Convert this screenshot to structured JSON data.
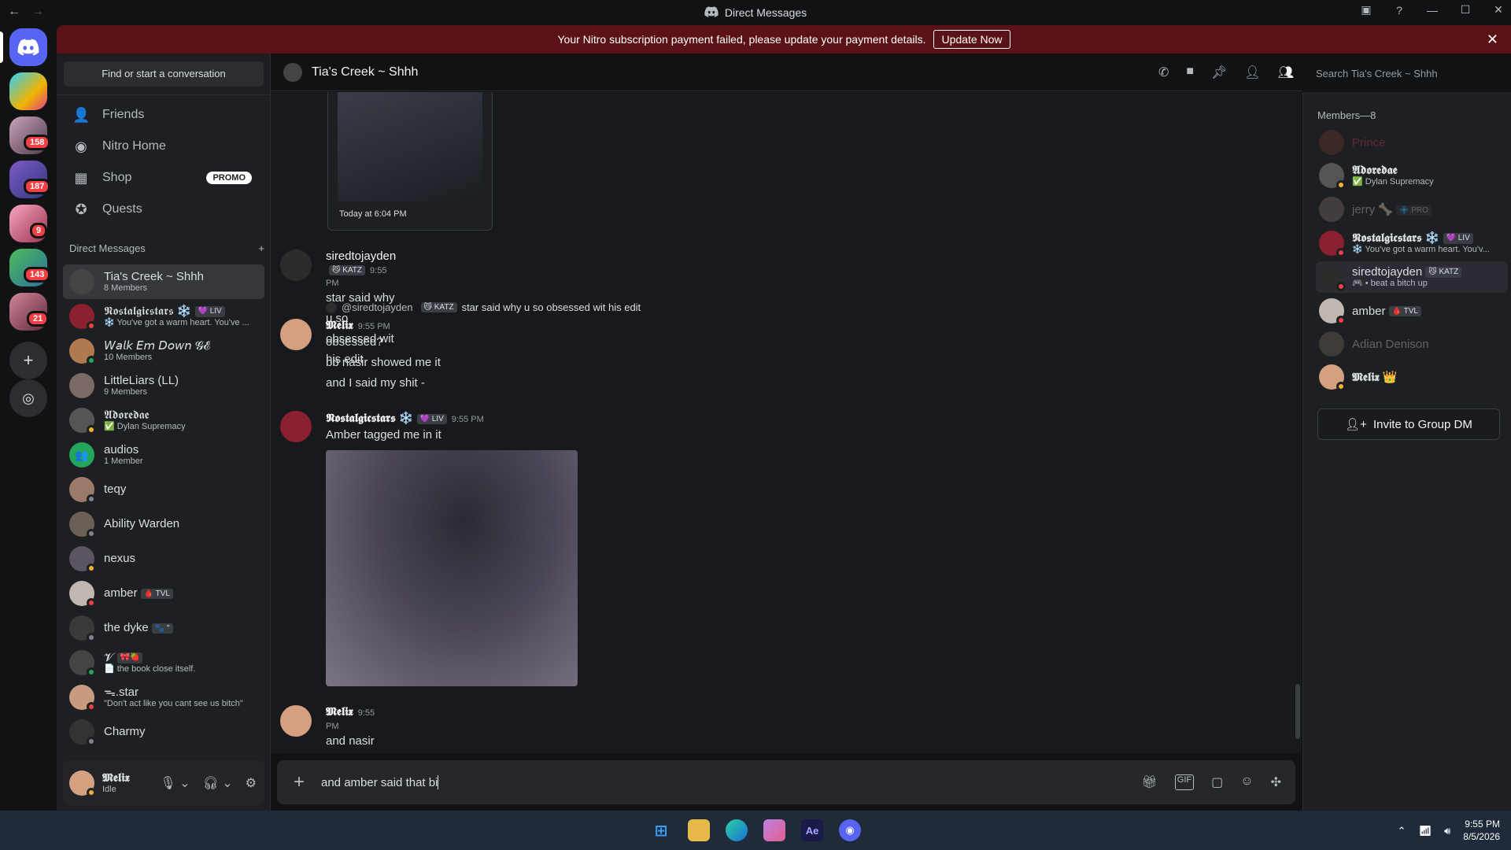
{
  "window": {
    "title": "Direct Messages"
  },
  "banner": {
    "text": "Your Nitro subscription payment failed, please update your payment details.",
    "button": "Update Now"
  },
  "rail": {
    "badges": [
      "158",
      "187",
      "9",
      "143",
      "21"
    ]
  },
  "sidebar": {
    "search_label": "Find or start a conversation",
    "nav": [
      "Friends",
      "Nitro Home",
      "Shop",
      "Quests"
    ],
    "promo": "PROMO",
    "dm_header": "Direct Messages",
    "dms": [
      {
        "name": "Tia's Creek ~ Shhh",
        "sub": "8 Members"
      },
      {
        "name": "𝕹𝖔𝖘𝖙𝖆𝖑𝖌𝖎𝖈𝖘𝖙𝖆𝖗𝖘 ❄️",
        "tag": "💜 LIV",
        "sub": "❄️ You've got a warm heart. You've ..."
      },
      {
        "name": "𝘞𝘢𝘭𝘬 𝘌𝘮 𝘋𝘰𝘸𝘯 𝓖𝓔",
        "sub": "10 Members"
      },
      {
        "name": "LittleLiars (LL)",
        "sub": "9 Members"
      },
      {
        "name": "𝕬𝖉𝖔𝖗𝖊𝖉𝖆𝖊",
        "sub": "✅ Dylan Supremacy"
      },
      {
        "name": "audios",
        "sub": "1 Member"
      },
      {
        "name": "teqy",
        "sub": ""
      },
      {
        "name": "Ability Warden",
        "sub": ""
      },
      {
        "name": "nexus",
        "sub": ""
      },
      {
        "name": "amber",
        "tag": "🩸 TVL",
        "sub": ""
      },
      {
        "name": "the dyke",
        "tag": "🐾 \"",
        "sub": ""
      },
      {
        "name": "𝓥",
        "tag": "🎀🍓",
        "sub": "📄 the book close itself."
      },
      {
        "name": "ᯓ.star",
        "sub": "\"Don't act like you cant see us bitch\""
      },
      {
        "name": "Charmy",
        "sub": ""
      }
    ]
  },
  "user": {
    "name": "𝕸𝖊𝖑𝖎𝖝",
    "status": "Idle"
  },
  "chat": {
    "title": "Tia's Creek ~ Shhh",
    "search_placeholder": "Search Tia's Creek ~ Shhh",
    "image_caption": "Today at 6:04 PM",
    "messages": [
      {
        "author": "siredtojayden",
        "tag": "😼 KATZ",
        "time": "9:55 PM",
        "lines": [
          "star said why u so obsessed wit his edit"
        ]
      },
      {
        "reply_to": "@siredtojayden",
        "reply_tag": "😼 KATZ",
        "reply_text": "star said why u so obsessed wit his edit",
        "author": "𝕸𝖊𝖑𝖎𝖝",
        "time": "9:55 PM",
        "lines": [
          "obsessed?",
          "bb nasir showed me it",
          "and I said my shit -"
        ]
      },
      {
        "author": "𝕹𝖔𝖘𝖙𝖆𝖑𝖌𝖎𝖈𝖘𝖙𝖆𝖗𝖘 ❄️",
        "tag": "💜 LIV",
        "time": "9:55 PM",
        "lines": [
          "Amber tagged me in it"
        ]
      },
      {
        "author": "𝕸𝖊𝖑𝖎𝖝",
        "time": "9:55 PM",
        "lines": [
          "and nasir just brought it back up -"
        ]
      }
    ],
    "composer_value": "and amber said that bi"
  },
  "members": {
    "header": "Members—8",
    "list": [
      {
        "name": "Prince",
        "sub": ""
      },
      {
        "name": "𝕬𝖉𝖔𝖗𝖊𝖉𝖆𝖊",
        "sub": "✅ Dylan Supremacy"
      },
      {
        "name": "jerry 🦴",
        "tag": "💠 PRO",
        "sub": ""
      },
      {
        "name": "𝕹𝖔𝖘𝖙𝖆𝖑𝖌𝖎𝖈𝖘𝖙𝖆𝖗𝖘 ❄️",
        "tag": "💜 LIV",
        "sub": "❄️ You've got a warm heart. You'v..."
      },
      {
        "name": "siredtojayden",
        "tag": "😼 KATZ",
        "sub": "🎮 • beat a bitch up"
      },
      {
        "name": "amber",
        "tag": "🩸 TVL",
        "sub": ""
      },
      {
        "name": "Adian Denison",
        "sub": ""
      },
      {
        "name": "𝕸𝖊𝖑𝖎𝖝 👑",
        "sub": ""
      }
    ],
    "invite": "Invite to Group DM"
  },
  "taskbar": {
    "time": "9:55 PM",
    "date": "8/5/2026"
  }
}
